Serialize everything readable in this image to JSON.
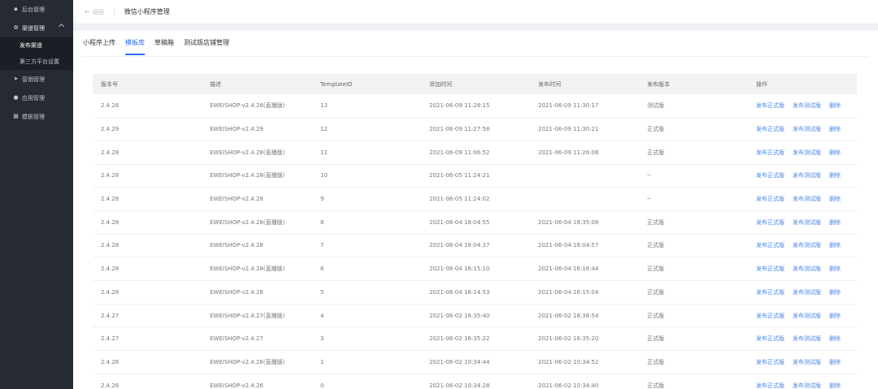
{
  "sidebar": {
    "items": [
      {
        "label": "后台管理",
        "icon": "app-icon"
      },
      {
        "label": "渠道管理",
        "icon": "channel-icon"
      },
      {
        "label": "营销管理",
        "icon": "marketing-icon"
      },
      {
        "label": "应用管理",
        "icon": "app-manage-icon"
      },
      {
        "label": "模板管理",
        "icon": "template-icon"
      }
    ],
    "submenu": [
      {
        "label": "发布渠道",
        "active": true
      },
      {
        "label": "第三方平台设置",
        "active": false
      }
    ]
  },
  "topbar": {
    "back_label": "返回",
    "title": "微信小程序管理"
  },
  "tabs": [
    {
      "label": "小程序上传",
      "active": false
    },
    {
      "label": "模板库",
      "active": true
    },
    {
      "label": "草稿箱",
      "active": false
    },
    {
      "label": "测试版店铺管理",
      "active": false
    }
  ],
  "table": {
    "columns": [
      "版本号",
      "描述",
      "TemplateID",
      "添加时间",
      "发布时间",
      "发布版本",
      "操作"
    ],
    "actions": [
      "发布正式版",
      "发布测试版",
      "删除"
    ],
    "rows": [
      [
        "2.4.28",
        "EWEISHOP-v2.4.28(直播版)",
        "13",
        "2021-06-09 11:28:15",
        "2021-06-09 11:30:17",
        "测试版"
      ],
      [
        "2.4.29",
        "EWEISHOP-v2.4.29",
        "12",
        "2021-06-09 11:27:58",
        "2021-06-09 11:30:21",
        "正式版"
      ],
      [
        "2.4.28",
        "EWEISHOP-v2.4.28(直播版)",
        "11",
        "2021-06-09 11:06:52",
        "2021-06-09 11:26:06",
        "正式版"
      ],
      [
        "2.4.28",
        "EWEISHOP-v2.4.28(直播版)",
        "10",
        "2021-06-05 11:24:21",
        "",
        "--"
      ],
      [
        "2.4.28",
        "EWEISHOP-v2.4.28",
        "9",
        "2021-06-05 11:24:02",
        "",
        "--"
      ],
      [
        "2.4.28",
        "EWEISHOP-v2.4.28(直播版)",
        "8",
        "2021-06-04 18:04:55",
        "2021-06-04 18:35:08",
        "正式版"
      ],
      [
        "2.4.28",
        "EWEISHOP-v2.4.28",
        "7",
        "2021-06-04 18:04:37",
        "2021-06-04 18:04:57",
        "正式版"
      ],
      [
        "2.4.28",
        "EWEISHOP-v2.4.28(直播版)",
        "6",
        "2021-06-04 16:15:10",
        "2021-06-04 16:16:44",
        "正式版"
      ],
      [
        "2.4.28",
        "EWEISHOP-v2.4.28",
        "5",
        "2021-06-04 16:14:53",
        "2021-06-04 16:15:04",
        "正式版"
      ],
      [
        "2.4.27",
        "EWEISHOP-v2.4.27(直播版)",
        "4",
        "2021-06-02 16:35:40",
        "2021-06-02 16:38:54",
        "正式版"
      ],
      [
        "2.4.27",
        "EWEISHOP-v2.4.27",
        "3",
        "2021-06-02 16:35:22",
        "2021-06-02 16:35:20",
        "正式版"
      ],
      [
        "2.4.26",
        "EWEISHOP-v2.4.26(直播版)",
        "1",
        "2021-06-02 10:34:44",
        "2021-06-02 10:34:52",
        "正式版"
      ],
      [
        "2.4.26",
        "EWEISHOP-v2.4.26",
        "0",
        "2021-06-02 10:34:28",
        "2021-06-02 10:34:40",
        "正式版"
      ]
    ]
  }
}
